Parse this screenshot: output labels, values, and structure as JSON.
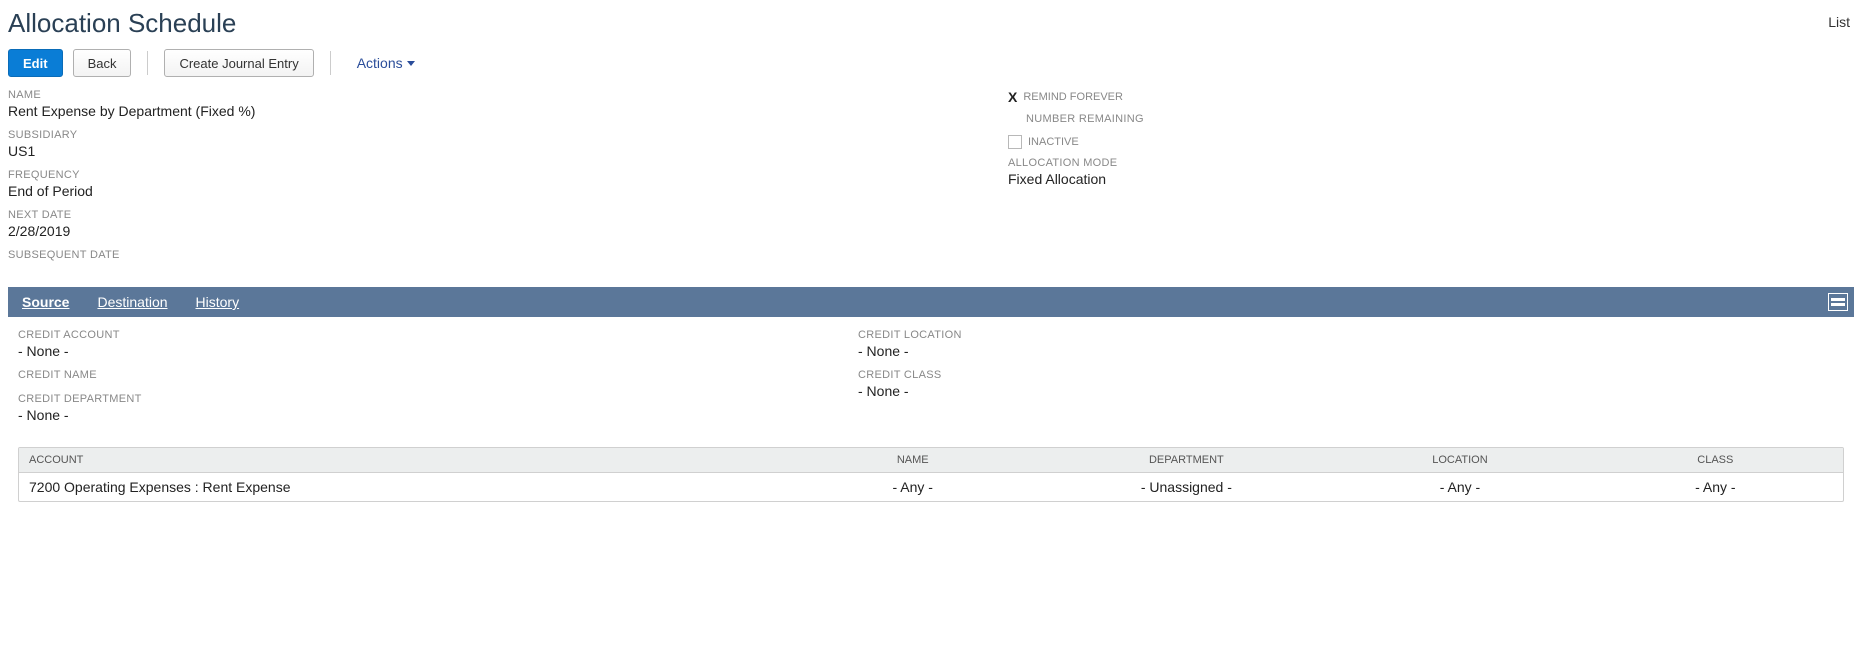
{
  "header": {
    "title": "Allocation Schedule",
    "list_link": "List"
  },
  "toolbar": {
    "edit": "Edit",
    "back": "Back",
    "create_journal": "Create Journal Entry",
    "actions": "Actions"
  },
  "fields_left": {
    "name_label": "NAME",
    "name_value": "Rent Expense by Department (Fixed %)",
    "subsidiary_label": "SUBSIDIARY",
    "subsidiary_value": "US1",
    "frequency_label": "FREQUENCY",
    "frequency_value": "End of Period",
    "next_date_label": "NEXT DATE",
    "next_date_value": "2/28/2019",
    "subsequent_date_label": "SUBSEQUENT DATE",
    "subsequent_date_value": ""
  },
  "fields_right": {
    "remind_x": "X",
    "remind_label": "REMIND FOREVER",
    "number_remaining_label": "NUMBER REMAINING",
    "inactive_label": "INACTIVE",
    "allocation_mode_label": "ALLOCATION MODE",
    "allocation_mode_value": "Fixed Allocation"
  },
  "tabs": {
    "source": "Source",
    "destination": "Destination",
    "history": "History"
  },
  "source": {
    "credit_account_label": "CREDIT ACCOUNT",
    "credit_account_value": "- None -",
    "credit_name_label": "CREDIT NAME",
    "credit_name_value": "",
    "credit_department_label": "CREDIT DEPARTMENT",
    "credit_department_value": "- None -",
    "credit_location_label": "CREDIT LOCATION",
    "credit_location_value": "- None -",
    "credit_class_label": "CREDIT CLASS",
    "credit_class_value": "- None -"
  },
  "grid": {
    "headers": {
      "account": "ACCOUNT",
      "name": "NAME",
      "department": "DEPARTMENT",
      "location": "LOCATION",
      "class": "CLASS"
    },
    "rows": [
      {
        "account": "7200 Operating Expenses : Rent Expense",
        "name": "- Any -",
        "department": "- Unassigned -",
        "location": "- Any -",
        "class": "- Any -"
      }
    ]
  }
}
